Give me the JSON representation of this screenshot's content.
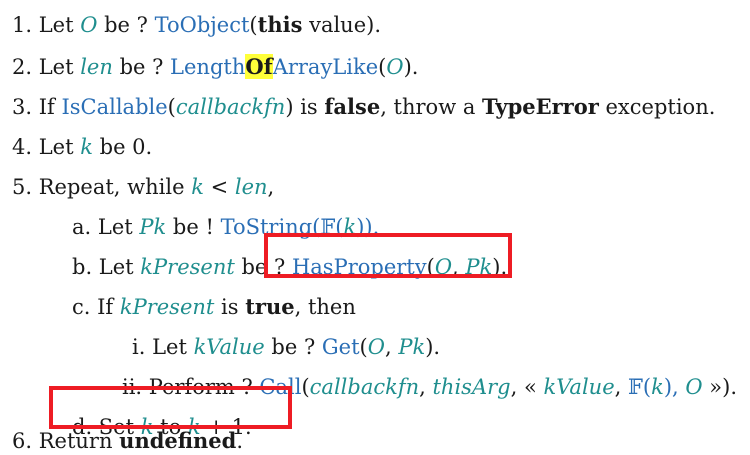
{
  "steps": {
    "s1": {
      "num": "1.",
      "t1": " Let ",
      "O": "O",
      "t2": " be ? ",
      "fn": "ToObject",
      "t3": "(",
      "kw": "this",
      "t4": " value)."
    },
    "s2": {
      "num": "2.",
      "t1": " Let ",
      "len": "len",
      "t2": " be ? ",
      "fn_a": "Length",
      "fn_hl": "Of",
      "fn_b": "ArrayLike",
      "t3": "(",
      "O": "O",
      "t4": ")."
    },
    "s3": {
      "num": "3.",
      "t1": " If ",
      "fn": "IsCallable",
      "t2": "(",
      "cb": "callbackfn",
      "t3": ") is ",
      "kw1": "false",
      "t4": ", throw a ",
      "kw2": "TypeError",
      "t5": " exception."
    },
    "s4": {
      "num": "4.",
      "t1": " Let ",
      "k": "k",
      "t2": " be 0."
    },
    "s5": {
      "num": "5.",
      "t1": " Repeat, while ",
      "k": "k",
      "t2": " < ",
      "len": "len",
      "t3": ","
    },
    "sa": {
      "num": "a.",
      "t1": " Let ",
      "Pk": "Pk",
      "t2": " be ! ",
      "fn": "ToString",
      "t3": "(",
      "F": "𝔽",
      "t4": "(",
      "k": "k",
      "t5": "))."
    },
    "sb": {
      "num": "b.",
      "t1": " Let ",
      "kp": "kPresent",
      "t2": " be ",
      "t3": "? ",
      "fn": "HasProperty",
      "t4": "(",
      "O": "O",
      "t5": ", ",
      "Pk": "Pk",
      "t6": ")."
    },
    "sc": {
      "num": "c.",
      "t1": " If ",
      "kp": "kPresent",
      "t2": " is ",
      "kw": "true",
      "t3": ", then"
    },
    "si": {
      "num": "i.",
      "t1": " Let ",
      "kv": "kValue",
      "t2": " be ? ",
      "fn": "Get",
      "t3": "(",
      "O": "O",
      "t4": ", ",
      "Pk": "Pk",
      "t5": ")."
    },
    "sii": {
      "num": "ii.",
      "t1": " Perform ? ",
      "fn": "Call",
      "t2": "(",
      "cb": "callbackfn",
      "t3": ", ",
      "ta": "thisArg",
      "t4": ", « ",
      "kv": "kValue",
      "t5": ", ",
      "F": "𝔽",
      "t6": "(",
      "k": "k",
      "t7": "), ",
      "O": "O",
      "t8": " »)."
    },
    "sd": {
      "num": "d.",
      "t1": " Set ",
      "k": "k",
      "t2": " to ",
      "k2": "k",
      "t3": " + 1."
    },
    "s6": {
      "num": "6.",
      "t1": " Return ",
      "kw": "undefined",
      "t2": "."
    }
  },
  "colors": {
    "link": "#2a6eb5",
    "var": "#1f8e8e",
    "highlight": "#ffff3a",
    "box": "#ee1c24"
  }
}
